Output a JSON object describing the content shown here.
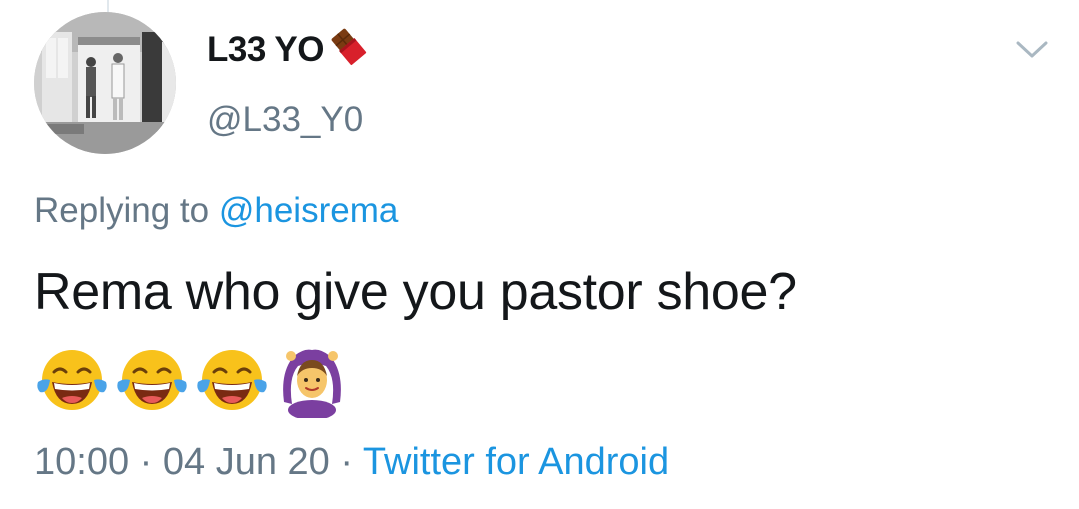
{
  "tweet": {
    "display_name": "L33 YO",
    "handle": "@L33_Y0",
    "replying_prefix": "Replying to",
    "replying_to": "@heisrema",
    "text": "Rema who give you pastor shoe?",
    "emojis": [
      "face-with-tears-of-joy-icon",
      "face-with-tears-of-joy-icon",
      "face-with-tears-of-joy-icon",
      "woman-gesturing-ok-icon"
    ],
    "time": "10:00",
    "separator": "·",
    "date": "04 Jun 20",
    "source": "Twitter for Android"
  },
  "colors": {
    "text_primary": "#14171a",
    "text_secondary": "#657786",
    "link": "#1b95e0",
    "chevron": "#aab8c2"
  },
  "icons": {
    "name_suffix": "chocolate-bar-icon",
    "menu": "chevron-down-icon"
  }
}
